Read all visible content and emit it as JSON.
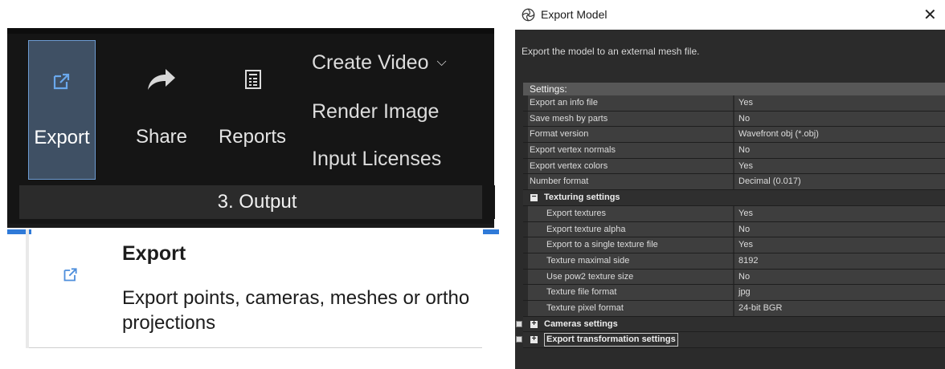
{
  "ribbon": {
    "buttons": {
      "export": "Export",
      "share": "Share",
      "reports": "Reports"
    },
    "small_buttons": {
      "create_video": "Create Video",
      "render_image": "Render Image",
      "input_licenses": "Input Licenses"
    },
    "section_label": "3. Output"
  },
  "tooltip": {
    "title": "Export",
    "description": "Export points, cameras, meshes or ortho projections"
  },
  "dialog": {
    "title": "Export Model",
    "description": "Export the model to an external mesh file.",
    "settings_header": "Settings:",
    "rows": [
      {
        "name": "Export an info file",
        "value": "Yes"
      },
      {
        "name": "Save mesh by parts",
        "value": "No"
      },
      {
        "name": "Format version",
        "value": "Wavefront obj (*.obj)"
      },
      {
        "name": "Export vertex normals",
        "value": "No"
      },
      {
        "name": "Export vertex colors",
        "value": "Yes"
      },
      {
        "name": "Number format",
        "value": "Decimal (0.017)"
      }
    ],
    "texturing_group": "Texturing settings",
    "texturing_rows": [
      {
        "name": "Export textures",
        "value": "Yes"
      },
      {
        "name": "Export texture alpha",
        "value": "No"
      },
      {
        "name": "Export to a single texture file",
        "value": "Yes"
      },
      {
        "name": "Texture maximal side",
        "value": "8192"
      },
      {
        "name": "Use pow2 texture size",
        "value": "No"
      },
      {
        "name": "Texture file format",
        "value": "jpg"
      },
      {
        "name": "Texture pixel format",
        "value": "24-bit BGR"
      }
    ],
    "cameras_group": "Cameras settings",
    "transform_group": "Export transformation settings"
  },
  "colors": {
    "accent": "#2f7ad8",
    "export_button_bg": "#3f5064",
    "icon_blue": "#4f8fdc"
  },
  "icons": [
    "export-icon",
    "share-icon",
    "reports-icon",
    "chevron-down-icon",
    "app-logo-icon",
    "close-icon",
    "collapse-icon",
    "expand-icon"
  ]
}
